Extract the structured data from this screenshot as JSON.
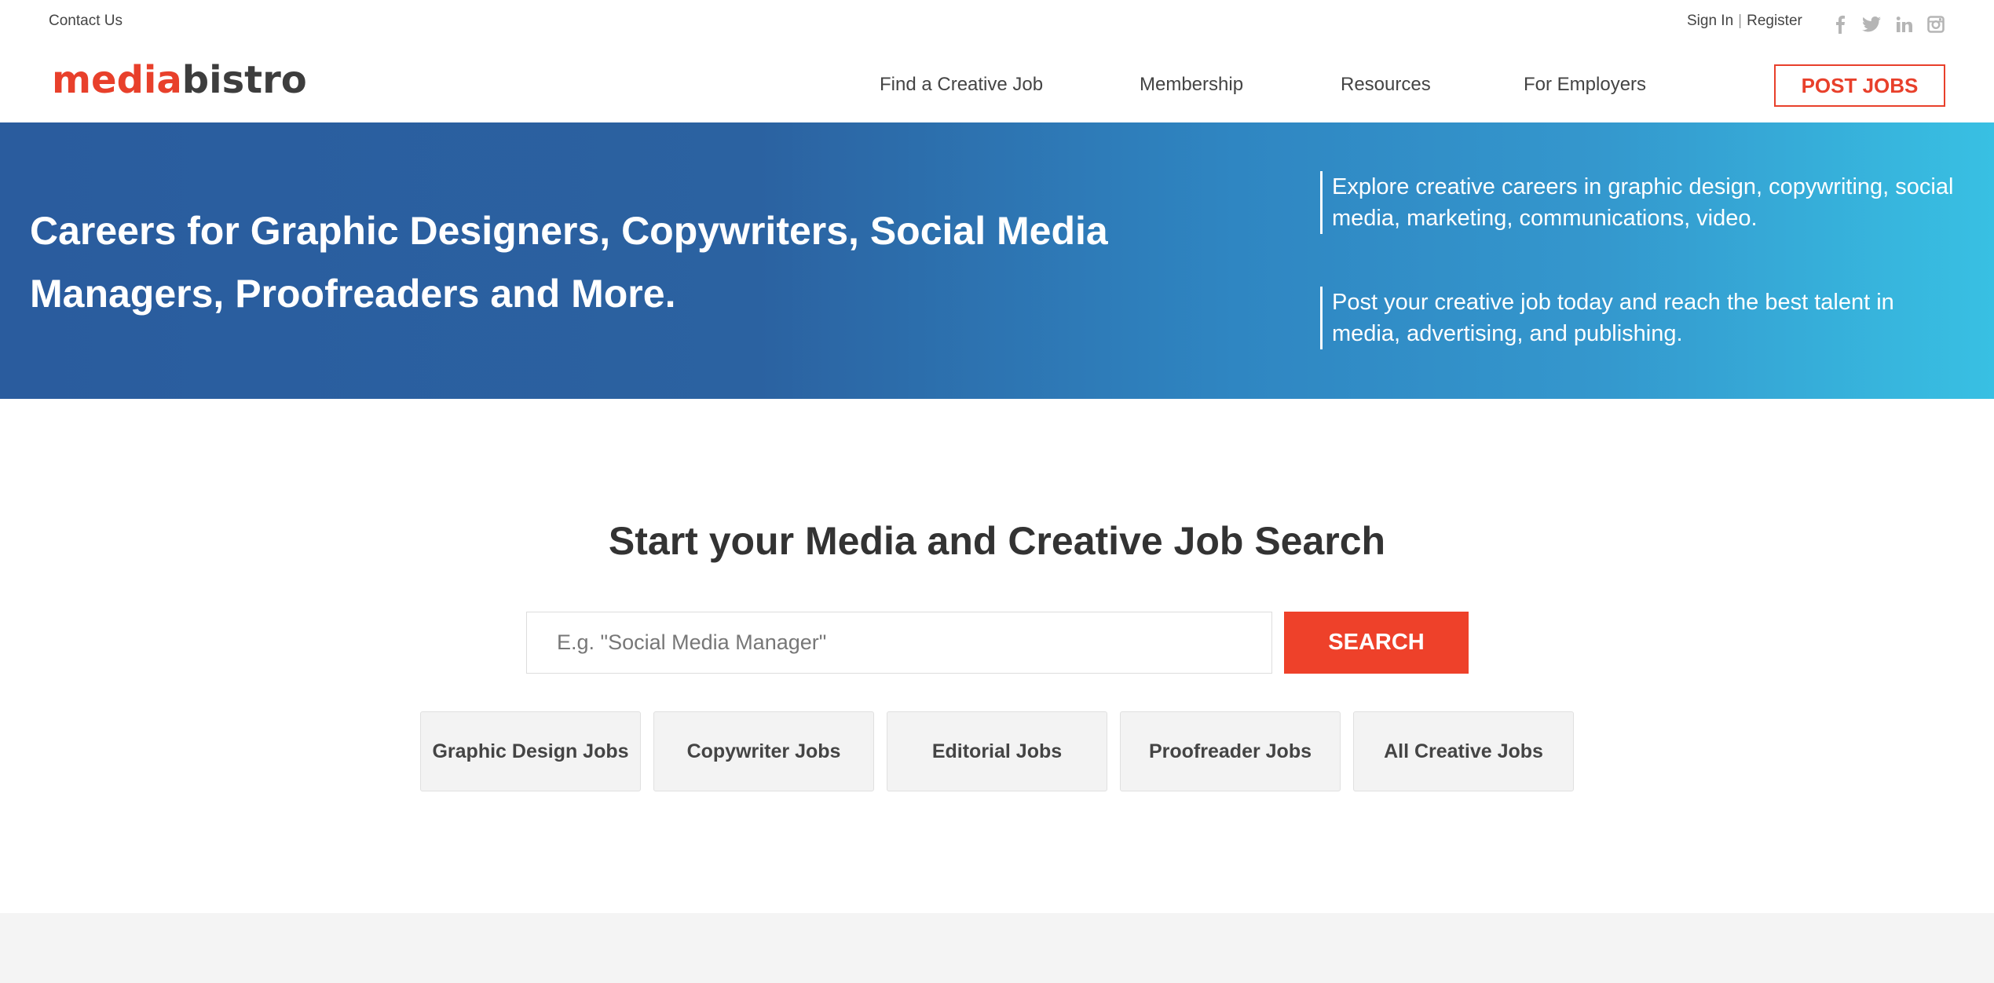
{
  "topbar": {
    "contact": "Contact Us",
    "sign_in": "Sign In",
    "separator": "|",
    "register": "Register",
    "social_icons": [
      "facebook-icon",
      "twitter-icon",
      "linkedin-icon",
      "instagram-icon"
    ]
  },
  "header": {
    "logo_part1": "media",
    "logo_part2": "bistro",
    "nav": [
      "Find a Creative Job",
      "Membership",
      "Resources",
      "For Employers"
    ],
    "post_jobs": "POST JOBS"
  },
  "hero": {
    "title": "Careers for Graphic Designers, Copywriters, Social Media Managers, Proofreaders and More.",
    "points": [
      "Explore creative careers in graphic design, copywriting, social media, marketing, communications, video.",
      "Post your creative job today and reach the best talent in media, advertising, and publishing."
    ]
  },
  "search": {
    "title": "Start your Media and Creative Job Search",
    "placeholder": "E.g. \"Social Media Manager\"",
    "value": "",
    "button": "SEARCH",
    "quick_links": [
      "Graphic Design Jobs",
      "Copywriter Jobs",
      "Editorial Jobs",
      "Proofreader Jobs",
      "All Creative Jobs"
    ]
  },
  "colors": {
    "brand_red": "#e8402b",
    "search_red": "#ee412a",
    "hero_gradient_start": "#2a5c9e",
    "hero_gradient_end": "#38c0e3",
    "text_dark": "#333333",
    "quick_link_bg": "#f3f3f3",
    "social_gray": "#b5b5b5"
  }
}
